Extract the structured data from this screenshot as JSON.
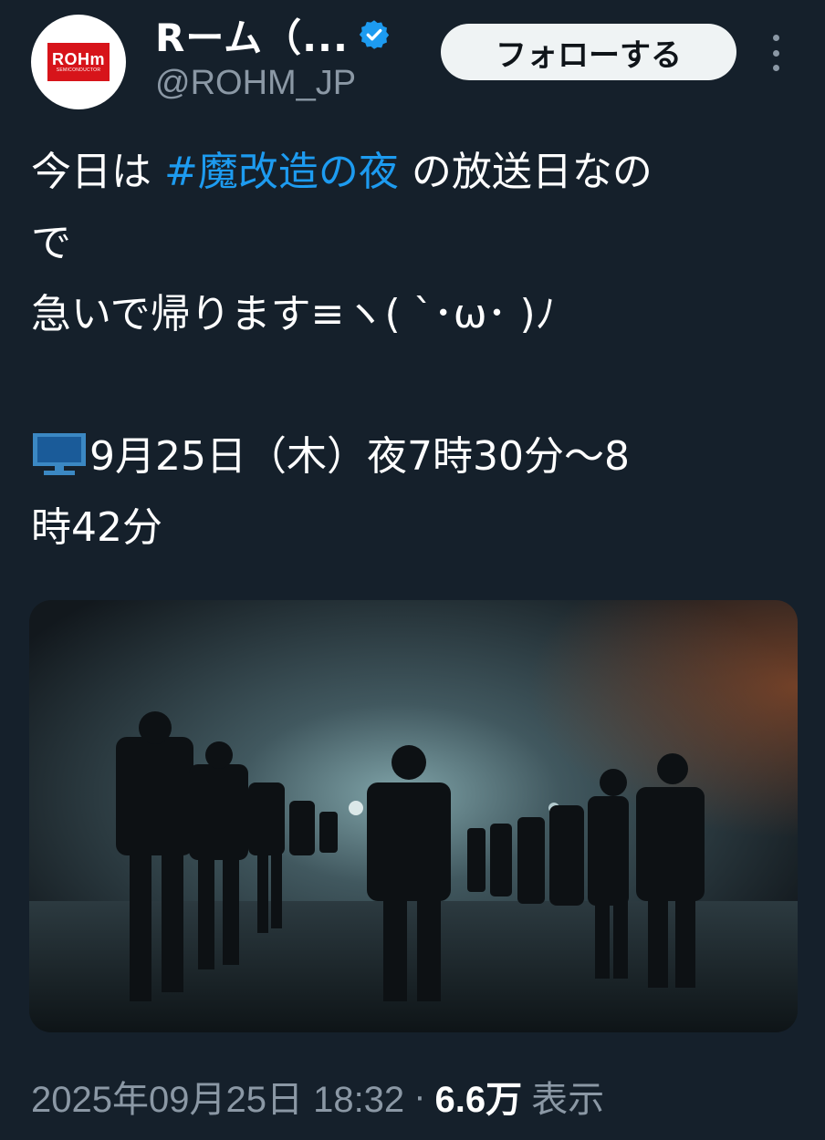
{
  "author": {
    "display_name": "Rーム（...",
    "handle": "@ROHM_JP",
    "verified": true,
    "avatar_logo": {
      "main": "ROHm",
      "sub": "SEMICONDUCTOR"
    }
  },
  "follow_label": "フォローする",
  "tweet": {
    "line1_prefix": "今日は ",
    "hashtag": "#魔改造の夜",
    "line1_suffix": " の放送日なの",
    "line2": "で",
    "line3": "急いで帰ります≡ヽ( ˋ･ω･ )ﾉ",
    "line5": "9月25日（木）夜7時30分〜8",
    "line6": "時42分",
    "tv_icon": "desktop-computer-icon"
  },
  "meta": {
    "timestamp": "2025年09月25日 18:32",
    "separator": "·",
    "views_count": "6.6万",
    "views_label": "表示"
  },
  "colors": {
    "background": "#15202b",
    "hashtag": "#1d9bf0",
    "secondary_text": "#8b98a5",
    "follow_button_bg": "#eff3f4",
    "brand_red": "#d7141a"
  }
}
